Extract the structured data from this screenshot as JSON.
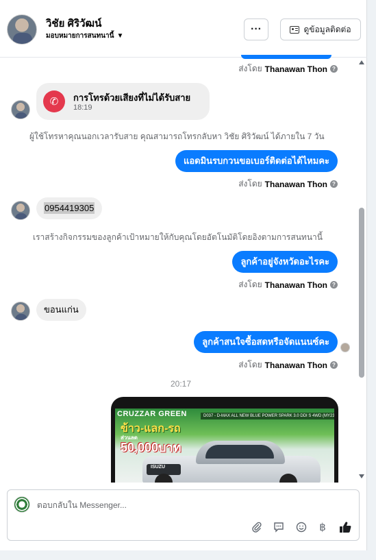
{
  "header": {
    "contact_name": "วิชัย ศิริวัฒน์",
    "assign_label": "มอบหมายการสนทนานี้",
    "more_label": "···",
    "info_label": "ดูข้อมูลติดต่อ"
  },
  "messages": {
    "sent_prefix": "ส่งโดย",
    "sender_name": "Thanawan Thon",
    "missed_call": {
      "title": "การโทรด้วยเสียงที่ไม่ได้รับสาย",
      "time": "18:19"
    },
    "call_system_note": "ผู้ใช้โทรหาคุณนอกเวลารับสาย คุณสามารถโทรกลับหา วิชัย ศิริวัฒน์ ได้ภายใน 7 วัน",
    "out_1": "แอดมินรบกวนขอเบอร์ติดต่อได้ไหมคะ",
    "in_phone": "0954419305",
    "activity_note": "เราสร้างกิจกรรมของลูกค้าเป้าหมายให้กับคุณโดยอัตโนมัติโดยอิงตามการสนทนานี้",
    "out_2": "ลูกค้าอยู่จังหวัดอะไรคะ",
    "in_province": "ขอนแก่น",
    "out_3": "ลูกค้าสนใจซื้อสดหรือจัดแนนซ์คะ",
    "timestamp": "20:17",
    "image_ad": {
      "brand": "CRUZZAR GREEN",
      "strip": "D037 - D-MAX ALL NEW BLUE POWER SPARK 3.0 DDI S 4WD (MY23) MT",
      "headline": "ข้าว-แลก-รถ",
      "sub": "ส่วนลด",
      "price": "50,000บาท",
      "car_logo": "ISUZU"
    }
  },
  "composer": {
    "placeholder": "ตอบกลับใน Messenger..."
  },
  "icons": {
    "attach": "paperclip-icon",
    "saved_reply": "chat-bubble-icon",
    "emoji": "smiley-icon",
    "payment": "baht-icon",
    "like": "thumbs-up-icon"
  }
}
